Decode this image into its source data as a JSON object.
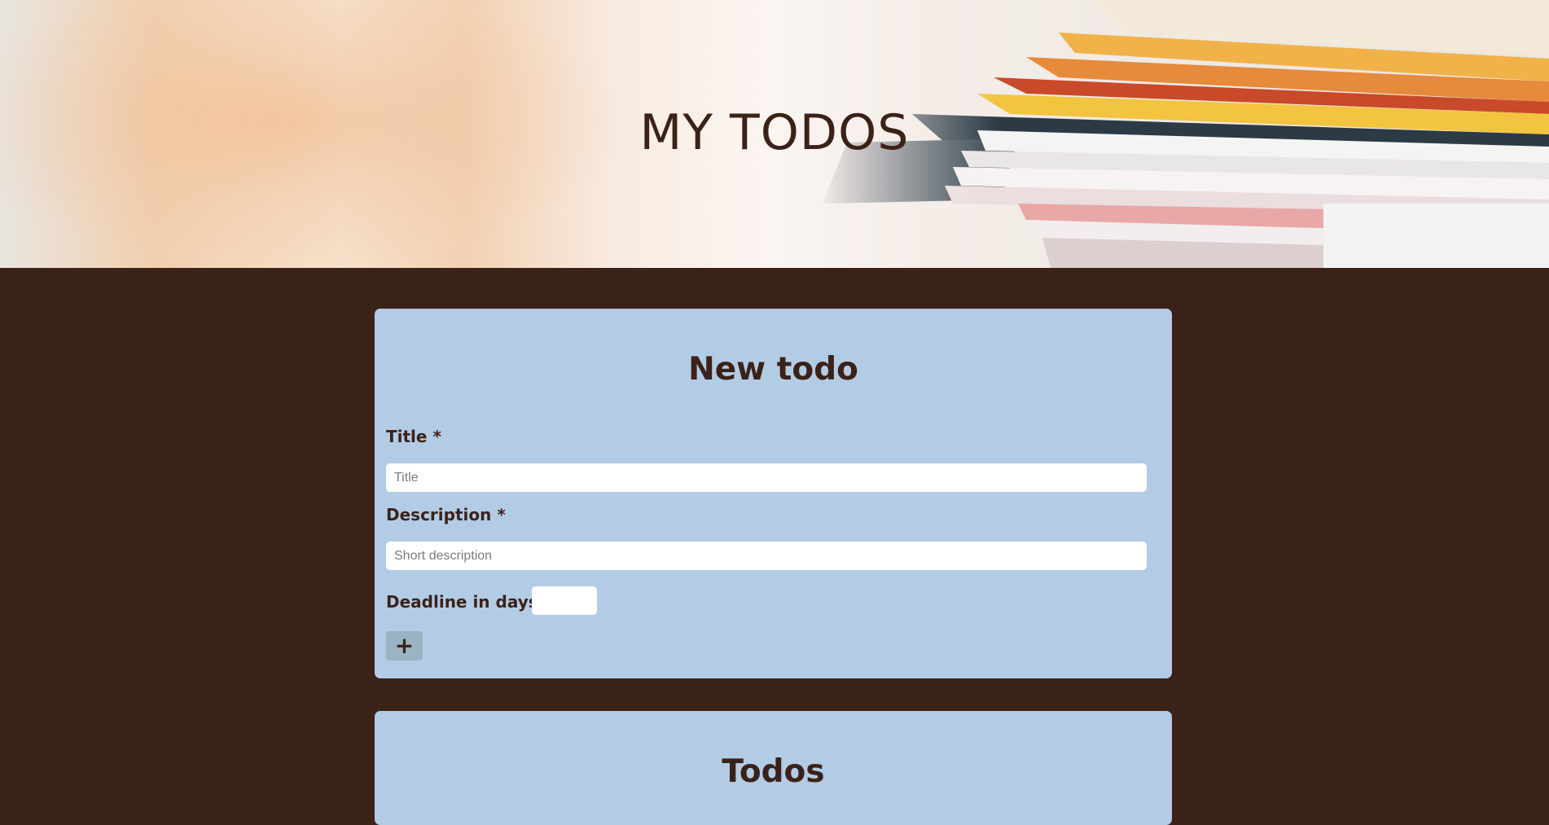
{
  "header": {
    "title": "MY TODOS"
  },
  "new_todo": {
    "heading": "New todo",
    "title_label": "Title *",
    "title_placeholder": "Title",
    "description_label": "Description *",
    "description_placeholder": "Short description",
    "deadline_label": "Deadline in days *",
    "deadline_value": "",
    "add_button_label": "+"
  },
  "todos": {
    "heading": "Todos"
  },
  "colors": {
    "page_background": "#3b2219",
    "card_background": "#b3cce6",
    "text": "#3b2219",
    "button_background": "#9bb4c4"
  }
}
